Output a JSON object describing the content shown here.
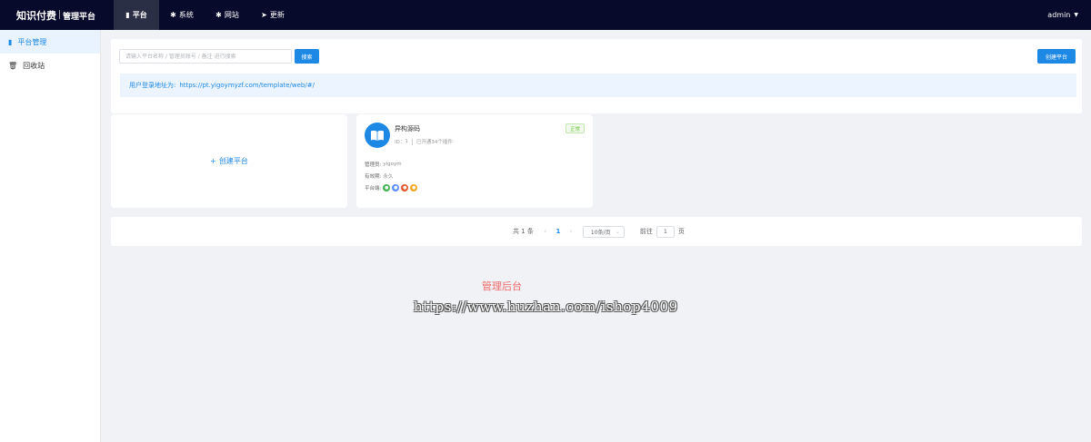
{
  "brand": {
    "main": "知识付费",
    "sub": "管理平台"
  },
  "topnav": [
    {
      "label": "平台",
      "icon": "monitor-icon",
      "active": true
    },
    {
      "label": "系统",
      "icon": "gear-icon"
    },
    {
      "label": "网站",
      "icon": "gear-icon"
    },
    {
      "label": "更新",
      "icon": "send-icon"
    }
  ],
  "user": {
    "name": "admin"
  },
  "sidebar": {
    "items": [
      {
        "label": "平台管理",
        "icon": "monitor-icon",
        "active": true
      },
      {
        "label": "回收站",
        "icon": "trash-icon"
      }
    ]
  },
  "search": {
    "placeholder": "请输入平台名称 / 管理员账号 / 备注 进行搜索",
    "value": "",
    "button": "搜索"
  },
  "create_button": "创建平台",
  "notice": {
    "label": "用户登录地址为:",
    "url": "https://pt.yigoymyzf.com/template/web/#/"
  },
  "create_card": {
    "label": "创建平台"
  },
  "platform": {
    "name": "异构源码",
    "id_label": "ID：",
    "id": "1",
    "plugins": "已开通34个插件",
    "status": "正常",
    "admin_label": "管理员:",
    "admin": "yigoym",
    "validity_label": "有效期:",
    "validity": "永久",
    "ends_label": "平台端:",
    "ends": [
      {
        "icon": "wechat-icon",
        "color": "#3fb34f"
      },
      {
        "icon": "mini-program-icon",
        "color": "#5b8ff9"
      },
      {
        "icon": "toutiao-icon",
        "color": "#e4572e"
      },
      {
        "icon": "h5-icon",
        "color": "#f5a623"
      }
    ]
  },
  "pagination": {
    "total": "共 1 条",
    "current": "1",
    "page_size": "10条/页",
    "goto_label": "前往",
    "goto_value": "1",
    "goto_unit": "页"
  },
  "watermark": {
    "title": "管理后台",
    "url": "https://www.huzhan.com/ishop4009"
  }
}
